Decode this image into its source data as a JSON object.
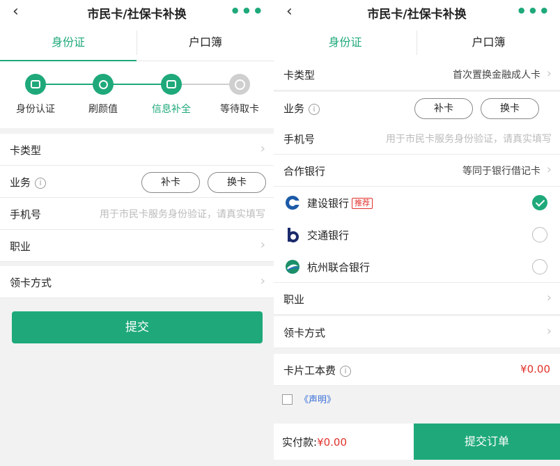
{
  "left": {
    "title": "市民卡/社保卡补换",
    "tabs": [
      "身份证",
      "户口簿"
    ],
    "steps": [
      "身份认证",
      "刷颜值",
      "信息补全",
      "等待取卡"
    ],
    "rows": {
      "card_type": "卡类型",
      "business": "业务",
      "phone": "手机号",
      "phone_placeholder": "用于市民卡服务身份验证，请真实填写",
      "occupation": "职业",
      "pickup": "领卡方式"
    },
    "buttons": {
      "reissue": "补卡",
      "replace": "换卡",
      "submit": "提交"
    }
  },
  "right": {
    "title": "市民卡/社保卡补换",
    "tabs": [
      "身份证",
      "户口簿"
    ],
    "rows": {
      "card_type": "卡类型",
      "card_type_value": "首次置换金融成人卡",
      "business": "业务",
      "phone": "手机号",
      "phone_placeholder": "用于市民卡服务身份验证，请真实填写",
      "bank": "合作银行",
      "bank_value": "等同于银行借记卡",
      "occupation": "职业",
      "pickup": "领卡方式",
      "fee": "卡片工本费",
      "fee_value": "¥0.00"
    },
    "banks": [
      {
        "name": "建设银行",
        "badge": "推荐",
        "selected": true
      },
      {
        "name": "交通银行",
        "selected": false
      },
      {
        "name": "杭州联合银行",
        "selected": false
      }
    ],
    "buttons": {
      "reissue": "补卡",
      "replace": "换卡"
    },
    "agreement": "《声明》",
    "footer": {
      "pay_label": "实付款:",
      "pay_value": "¥0.00",
      "order": "提交订单"
    }
  },
  "colors": {
    "accent": "#1fa97a",
    "price": "#e0322b",
    "link": "#3a6fd8"
  }
}
